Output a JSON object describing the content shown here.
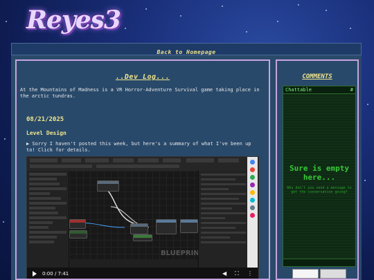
{
  "site": {
    "logo_text": "Reyes3",
    "nav_link": "Back to Homepage"
  },
  "devlog": {
    "title": "..Dev Log...",
    "intro": "At the Mountains of Madness is a VR Horror-Adventure Survival game taking place in the arctic tundras.",
    "entries": [
      {
        "date": "08/21/2025",
        "section": "Level Design",
        "summary": "▶ Sorry I haven't posted this week, but here's a summary of what I've been up to! Click for details."
      }
    ]
  },
  "video": {
    "watermark": "BLUEPRINT",
    "time": "0:00 / 7:41",
    "play_icon": "play-icon",
    "volume_icon": "volume-icon",
    "fullscreen_icon": "fullscreen-icon",
    "menu_icon": "more-icon"
  },
  "comments": {
    "title": "COMMENTS",
    "chat_name": "Chattable",
    "chat_hash": "#",
    "empty_title": "Sure is empty here...",
    "empty_sub": "Why don't you send a message to get the conversation going?"
  },
  "colors": {
    "accent_yellow": "#f0e68c",
    "panel": "#29496a",
    "border": "#c8a4e0",
    "chat_green": "#39c839"
  }
}
